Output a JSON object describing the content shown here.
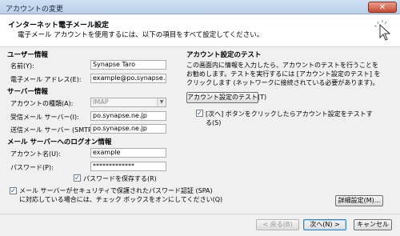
{
  "window": {
    "title": "アカウントの変更",
    "close_symbol": "✕"
  },
  "header": {
    "title": "インターネット電子メール設定",
    "subtitle": "電子メール アカウントを使用するには、以下の項目をすべて設定してください。"
  },
  "user_info": {
    "section_title": "ユーザー情報",
    "name_label": "名前(Y):",
    "name_value": "Synapse Taro",
    "email_label": "電子メール アドレス(E):",
    "email_value": "example@po.synapse.ne.jp"
  },
  "server_info": {
    "section_title": "サーバー情報",
    "account_type_label": "アカウントの種類(A):",
    "account_type_value": "IMAP",
    "incoming_label": "受信メール サーバー(I):",
    "incoming_value": "po.synapse.ne.jp",
    "outgoing_label": "送信メール サーバー (SMTP)(O):",
    "outgoing_value": "po.synapse.ne.jp"
  },
  "logon_info": {
    "section_title": "メール サーバーへのログオン情報",
    "account_name_label": "アカウント名(U):",
    "account_name_value": "example",
    "password_label": "パスワード(P):",
    "password_value": "*************",
    "remember_password_label": "パスワードを保存する(R)",
    "remember_password_checked": true,
    "spa_label_line1": "メール サーバーがセキュリティで保護されたパスワード認証 (SPA)",
    "spa_label_line2": "に対応している場合には、チェック ボックスをオンにしてください(Q)",
    "spa_checked": true
  },
  "test": {
    "section_title": "アカウント設定のテスト",
    "desc_line1": "この画面内に情報を入力したら、アカウントのテストを行うことを",
    "desc_line2": "お勧めします。テストを実行するには [アカウント設定のテスト] を",
    "desc_line3": "クリックします (ネットワークに接続されている必要があります)。",
    "test_button": "アカウント設定のテスト(T)",
    "next_test_label_line1": "[次へ] ボタンをクリックしたらアカウント設定をテストす",
    "next_test_label_line2": "る(S)",
    "next_test_checked": true
  },
  "buttons": {
    "more_settings": "詳細設定(M)...",
    "back": "< 戻る(B)",
    "next": "次へ(N) >",
    "cancel": "キャンセル"
  },
  "check_mark": "✓"
}
